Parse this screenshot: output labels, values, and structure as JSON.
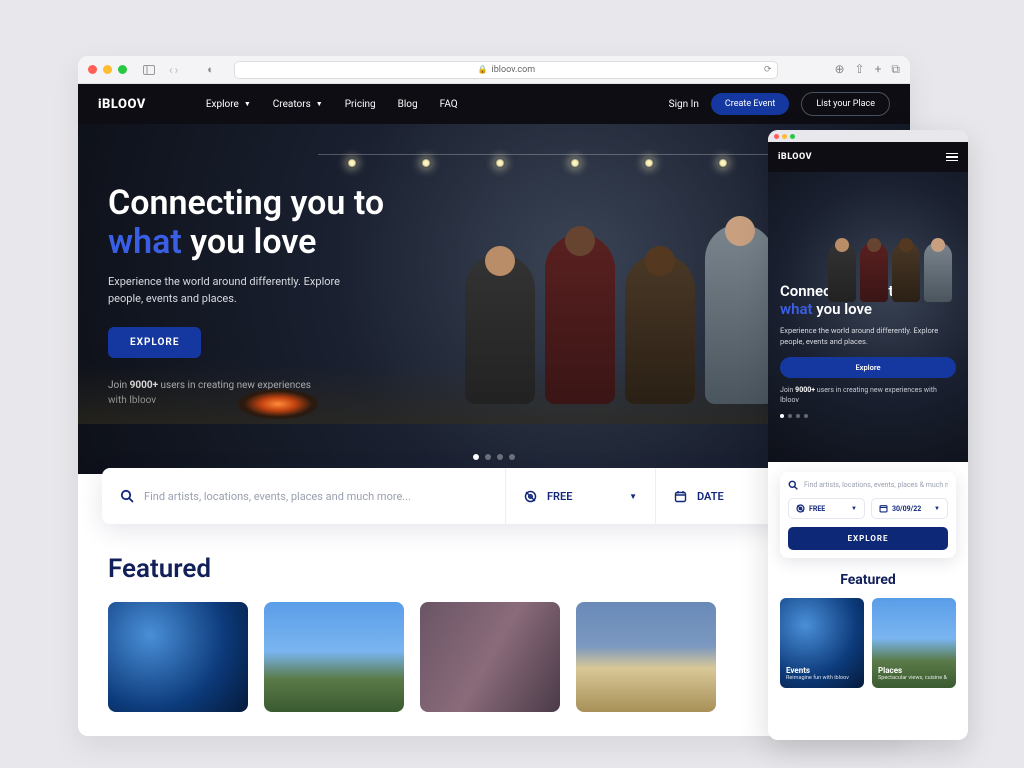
{
  "browser": {
    "url_host": "ibloov.com"
  },
  "brand": "iBLOOV",
  "nav": {
    "items": [
      "Explore",
      "Creators",
      "Pricing",
      "Blog",
      "FAQ"
    ],
    "sign_in": "Sign In",
    "create_event": "Create Event",
    "list_place": "List your Place"
  },
  "hero": {
    "line1": "Connecting you to",
    "accent": "what",
    "line2_rest": "you love",
    "sub": "Experience the world around differently. Explore people, events and places.",
    "cta": "EXPLORE",
    "join_prefix": "Join ",
    "join_count": "9000+",
    "join_suffix": " users in creating new experiences with Ibloov"
  },
  "search": {
    "placeholder": "Find artists, locations, events, places and much more...",
    "free": "FREE",
    "date": "DATE"
  },
  "featured": {
    "title": "Featured"
  },
  "mobile": {
    "hero_cta": "Explore",
    "search_placeholder": "Find artists, locations, events, places & much more...",
    "free": "FREE",
    "date_value": "30/09/22",
    "explore_btn": "EXPLORE",
    "featured": "Featured",
    "cards": [
      {
        "title": "Events",
        "sub": "Reimagine fun with ibloov"
      },
      {
        "title": "Places",
        "sub": "Spectacular views, cuisine &"
      }
    ]
  }
}
